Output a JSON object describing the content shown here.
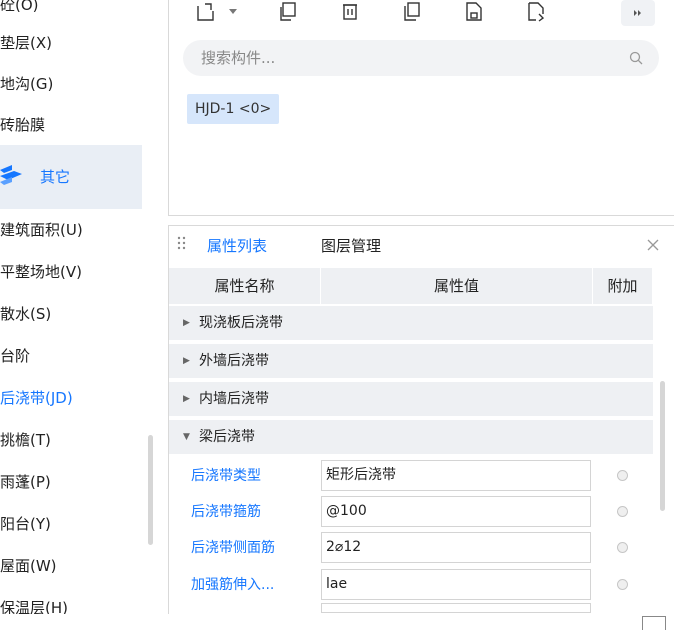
{
  "sidebar": {
    "items_top": [
      {
        "label": "砼(O)"
      },
      {
        "label": "垫层(X)"
      },
      {
        "label": "地沟(G)"
      },
      {
        "label": "砖胎膜"
      }
    ],
    "group": {
      "label": "其它",
      "icon": "layers-icon",
      "accent": "#1677ff"
    },
    "items_bottom": [
      {
        "label": "建筑面积(U)"
      },
      {
        "label": "平整场地(V)"
      },
      {
        "label": "散水(S)"
      },
      {
        "label": "台阶"
      },
      {
        "label": "后浇带(JD)",
        "active": true
      },
      {
        "label": "挑檐(T)"
      },
      {
        "label": "雨蓬(P)"
      },
      {
        "label": "阳台(Y)"
      },
      {
        "label": "屋面(W)"
      },
      {
        "label": "保温层(H)"
      }
    ]
  },
  "component_panel": {
    "toolbar": [
      "new-component-icon",
      "dropdown-caret-icon",
      "copy-icon",
      "delete-icon",
      "duplicate-layer-icon",
      "save-to-library-icon",
      "extract-from-library-icon",
      "more-icon"
    ],
    "search": {
      "placeholder": "搜索构件..."
    },
    "components": [
      {
        "label": "HJD-1 <0>"
      }
    ]
  },
  "properties_panel": {
    "tabs": [
      {
        "label": "属性列表",
        "active": true
      },
      {
        "label": "图层管理"
      }
    ],
    "columns": [
      "属性名称",
      "属性值",
      "附加"
    ],
    "groups": [
      {
        "label": "现浇板后浇带",
        "expanded": false
      },
      {
        "label": "外墙后浇带",
        "expanded": false
      },
      {
        "label": "内墙后浇带",
        "expanded": false
      },
      {
        "label": "梁后浇带",
        "expanded": true
      }
    ],
    "rows": [
      {
        "name": "后浇带类型",
        "value": "矩形后浇带"
      },
      {
        "name": "后浇带箍筋",
        "value": "@100"
      },
      {
        "name": "后浇带侧面筋",
        "value": "2⌀12"
      },
      {
        "name": "加强筋伸入...",
        "value": "lae"
      }
    ]
  },
  "colors": {
    "accent": "#1677ff",
    "header_bg": "#eef0f3",
    "tag_bg": "#d6e6fb"
  }
}
